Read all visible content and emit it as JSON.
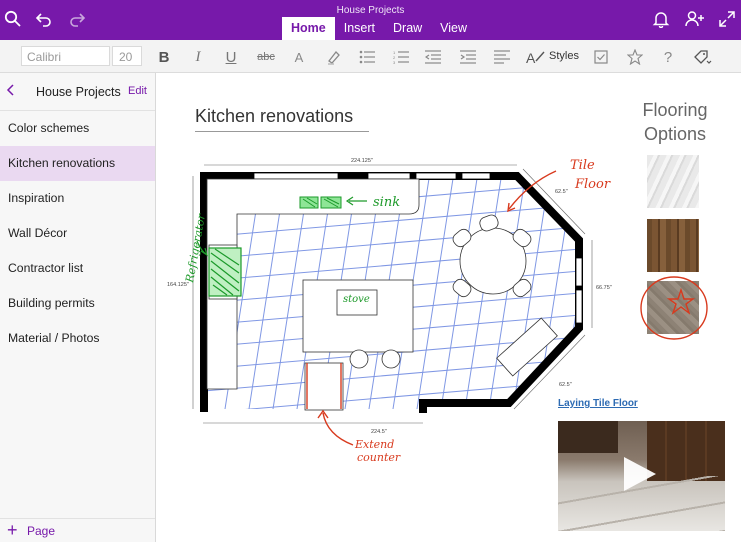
{
  "app": {
    "notebook_title": "House Projects",
    "tabs": [
      {
        "label": "Home",
        "active": true
      },
      {
        "label": "Insert",
        "active": false
      },
      {
        "label": "Draw",
        "active": false
      },
      {
        "label": "View",
        "active": false
      }
    ],
    "brand_color": "#7719aa"
  },
  "toolbar": {
    "font_name": "Calibri",
    "font_size": "20",
    "bold": "B",
    "italic": "I",
    "underline": "U",
    "strike": "abc",
    "font_color": "A",
    "styles_label": "Styles"
  },
  "sidebar": {
    "section_title": "House Projects",
    "edit_label": "Edit",
    "items": [
      {
        "label": "Color schemes",
        "selected": false
      },
      {
        "label": "Kitchen renovations",
        "selected": true
      },
      {
        "label": "Inspiration",
        "selected": false
      },
      {
        "label": "Wall Décor",
        "selected": false
      },
      {
        "label": "Contractor list",
        "selected": false
      },
      {
        "label": "Building permits",
        "selected": false
      },
      {
        "label": "Material / Photos",
        "selected": false
      }
    ],
    "add_page_label": "Page"
  },
  "page": {
    "title": "Kitchen renovations",
    "floorplan": {
      "dim_top": "224.125\"",
      "dim_left": "164.125\"",
      "dim_right": "66.75\"",
      "dim_angle_top": "62.5\"",
      "dim_angle_bottom": "62.5\"",
      "dim_bottom": "224.5\"",
      "notes": [
        "Tile",
        "Floor",
        "sink",
        "Refrigerator",
        "stove",
        "Extend",
        "counter"
      ]
    },
    "flooring_title_1": "Flooring",
    "flooring_title_2": "Options",
    "swatches": [
      "marble",
      "wood",
      "stone"
    ],
    "video_link": "Laying Tile Floor"
  }
}
